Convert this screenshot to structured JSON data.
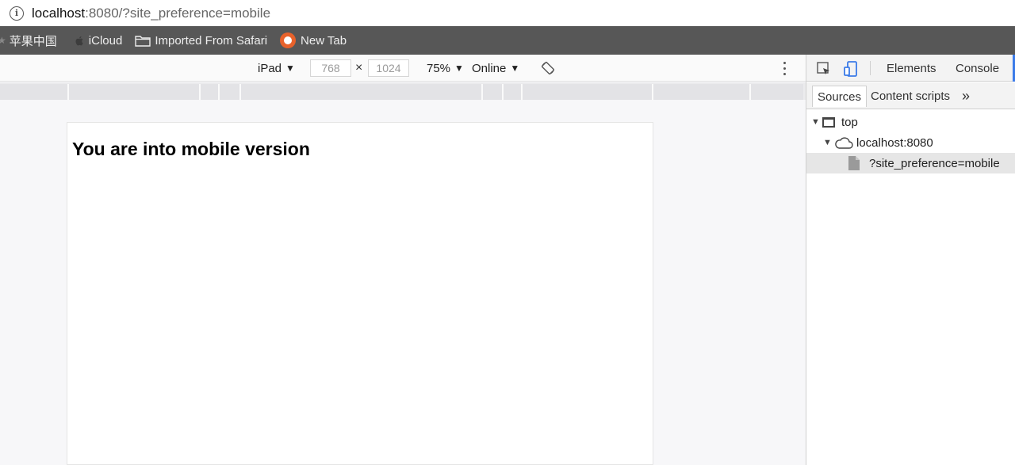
{
  "address_bar": {
    "url_host": "localhost",
    "url_rest": ":8080/?site_preference=mobile"
  },
  "bookmarks": [
    {
      "label": "苹果中国",
      "icon": "star-icon"
    },
    {
      "label": "iCloud",
      "icon": "apple-icon"
    },
    {
      "label": "Imported From Safari",
      "icon": "folder-icon"
    },
    {
      "label": "New Tab",
      "icon": "newtab-icon"
    }
  ],
  "device_toolbar": {
    "device": "iPad",
    "width_value": "768",
    "height_value": "1024",
    "times": "×",
    "zoom": "75%",
    "network": "Online"
  },
  "page": {
    "heading": "You are into mobile version"
  },
  "devtools": {
    "tabs": [
      "Elements",
      "Console"
    ],
    "subtabs": [
      "Sources",
      "Content scripts"
    ],
    "more": "»",
    "tree": [
      {
        "label": "top",
        "level": 0,
        "icon": "frame-icon"
      },
      {
        "label": "localhost:8080",
        "level": 1,
        "icon": "cloud-icon"
      },
      {
        "label": "?site_preference=mobile",
        "level": 2,
        "icon": "file-icon"
      }
    ]
  },
  "colors": {
    "bookmarks_bg": "#575757",
    "accent": "#3b7be8",
    "selected_row": "#e6e6e6"
  }
}
